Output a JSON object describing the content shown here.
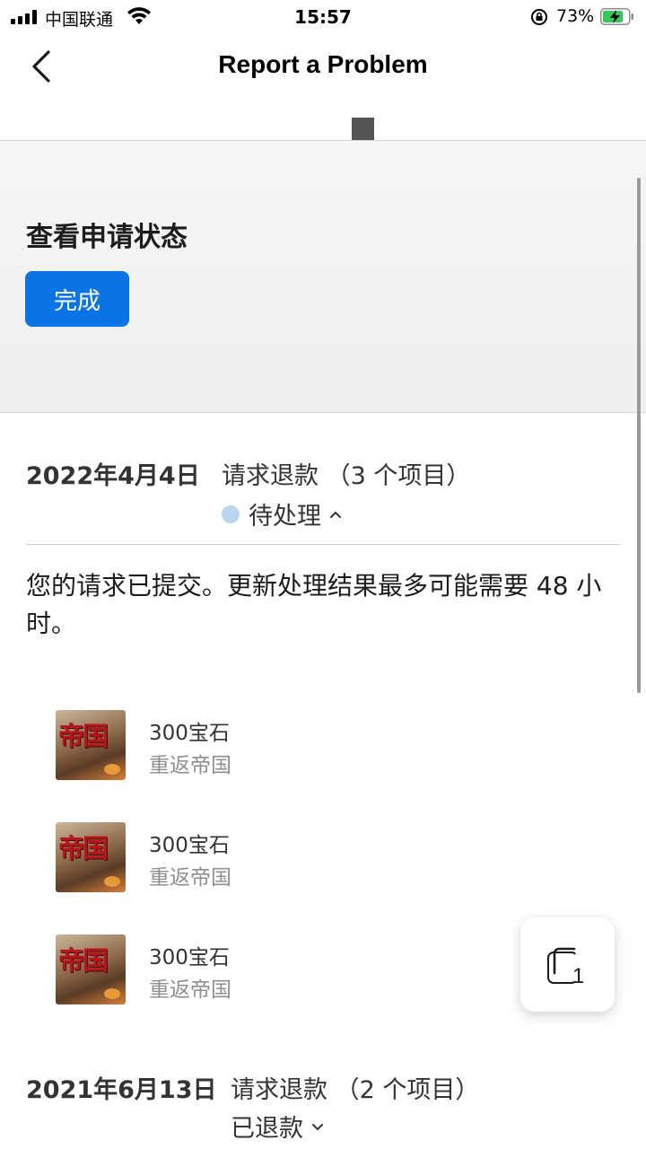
{
  "status_bar": {
    "carrier": "中国联通",
    "time": "15:57",
    "battery_percent": "73%"
  },
  "nav": {
    "title": "Report a Problem"
  },
  "status_section": {
    "title": "查看申请状态",
    "done_label": "完成"
  },
  "requests": [
    {
      "date": "2022年4月4日",
      "type": "请求退款 （3 个项目）",
      "status": "待处理",
      "message": "您的请求已提交。更新处理结果最多可能需要 48 小时。",
      "items": [
        {
          "name": "300宝石",
          "app": "重返帝国",
          "thumb_text": "帝国"
        },
        {
          "name": "300宝石",
          "app": "重返帝国",
          "thumb_text": "帝国"
        },
        {
          "name": "300宝石",
          "app": "重返帝国",
          "thumb_text": "帝国"
        }
      ]
    },
    {
      "date": "2021年6月13日",
      "type": "请求退款 （2 个项目）",
      "status": "已退款"
    }
  ],
  "floating_button": {
    "count": "1"
  },
  "colors": {
    "accent": "#0a73e6",
    "pending_dot": "#b9d6ee"
  }
}
